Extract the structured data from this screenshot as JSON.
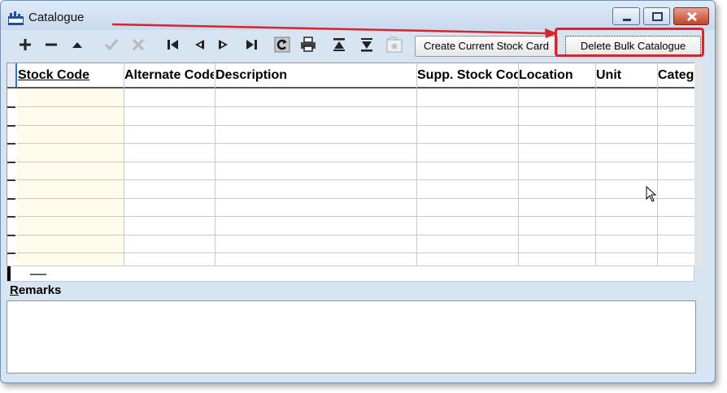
{
  "window": {
    "title": "Catalogue"
  },
  "toolbar": {
    "icons": [
      "add-icon",
      "delete-icon",
      "up-icon",
      "confirm-icon",
      "cancel-icon",
      "first-record-icon",
      "previous-record-icon",
      "next-record-icon",
      "last-record-icon",
      "refresh-icon",
      "print-icon",
      "sort-ascending-icon",
      "sort-descending-icon",
      "attachment-icon"
    ],
    "create_label": "Create Current Stock Card",
    "delete_label": "Delete Bulk Catalogue"
  },
  "grid": {
    "columns": [
      "Stock Code",
      "Alternate Code",
      "Description",
      "Supp. Stock Code",
      "Location",
      "Unit",
      "Categ"
    ]
  },
  "remarks": {
    "label_first": "R",
    "label_rest": "emarks",
    "value": ""
  },
  "colors": {
    "highlight": "#d9232d",
    "title_bar": "#c9daee",
    "window_bg": "#d7e4f2"
  }
}
